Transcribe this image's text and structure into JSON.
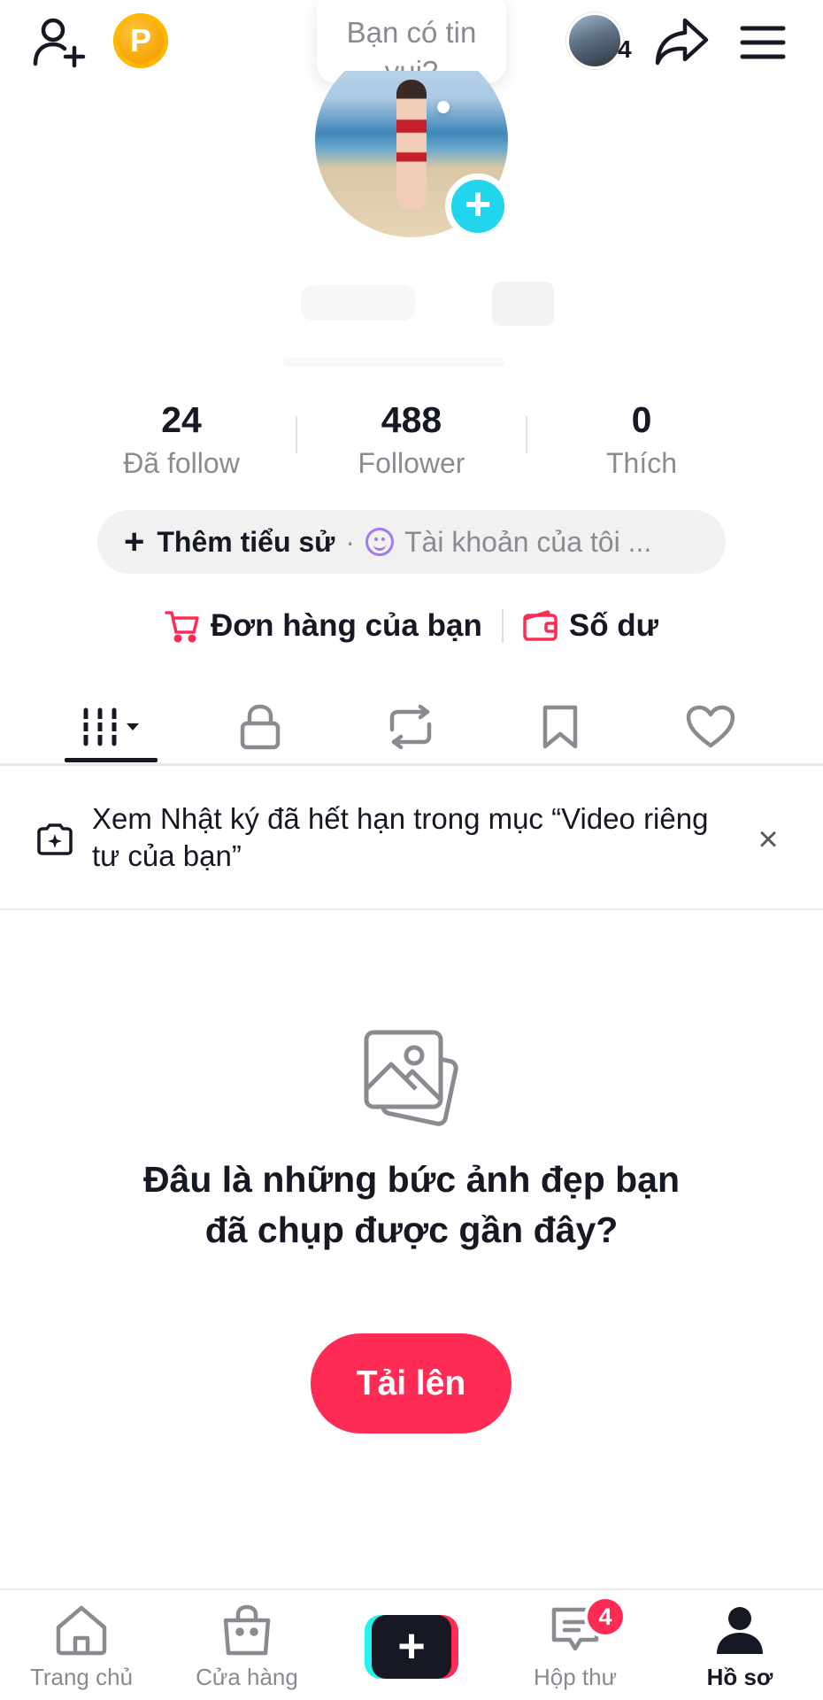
{
  "header": {
    "coin_letter": "P",
    "bubble_text": "Bạn có tin\nvui?",
    "friends_count": "4"
  },
  "stats": [
    {
      "value": "24",
      "label": "Đã follow"
    },
    {
      "value": "488",
      "label": "Follower"
    },
    {
      "value": "0",
      "label": "Thích"
    }
  ],
  "bio": {
    "add_label": "Thêm tiểu sử",
    "separator": "·",
    "account_label": "Tài khoản của tôi ..."
  },
  "shop": {
    "orders_label": "Đơn hàng của bạn",
    "balance_label": "Số dư"
  },
  "tabs": [
    {
      "name": "videos",
      "icon": "grid-icon"
    },
    {
      "name": "private",
      "icon": "lock-icon"
    },
    {
      "name": "reposts",
      "icon": "repost-icon"
    },
    {
      "name": "favorites",
      "icon": "bookmark-icon"
    },
    {
      "name": "liked",
      "icon": "heart-icon"
    }
  ],
  "notice": {
    "text": "Xem Nhật ký đã hết hạn trong mục “Video riêng tư của bạn”",
    "close": "×"
  },
  "empty_state": {
    "title": "Đâu là những bức ảnh đẹp bạn đã chụp được gần đây?",
    "upload_label": "Tải lên"
  },
  "bottom_nav": {
    "home": "Trang chủ",
    "shop": "Cửa hàng",
    "create": "+",
    "inbox": "Hộp thư",
    "inbox_badge": "4",
    "profile": "Hồ sơ"
  },
  "colors": {
    "accent": "#fe2c55",
    "teal": "#25f4ee",
    "add_avatar": "#20d5ec",
    "coin": "#f5a000",
    "muted_text": "#8a8b91",
    "primary_text": "#161823"
  }
}
